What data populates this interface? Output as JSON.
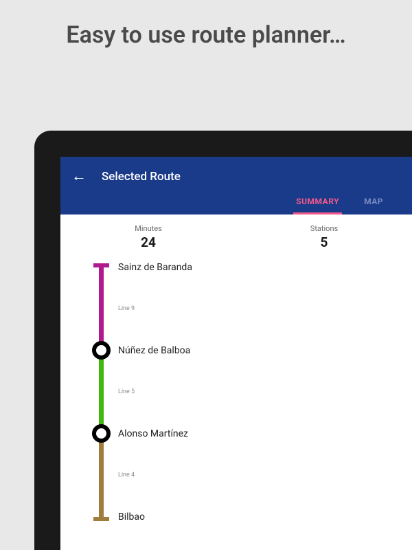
{
  "promo": {
    "heading": "Easy to use route planner…"
  },
  "appbar": {
    "title": "Selected Route",
    "tabs": {
      "summary": "SUMMARY",
      "map": "MAP"
    }
  },
  "stats": {
    "minutes_label": "Minutes",
    "minutes_value": "24",
    "stations_label": "Stations",
    "stations_value": "5"
  },
  "route": {
    "stops": [
      {
        "name": "Sainz de Baranda"
      },
      {
        "name": "Núñez de Balboa"
      },
      {
        "name": "Alonso Martínez"
      },
      {
        "name": "Bilbao"
      }
    ],
    "segments": [
      {
        "label": "Line 9",
        "color": "#b11a8f"
      },
      {
        "label": "Line 5",
        "color": "#3fb810"
      },
      {
        "label": "Line 4",
        "color": "#a07d3a"
      }
    ]
  }
}
